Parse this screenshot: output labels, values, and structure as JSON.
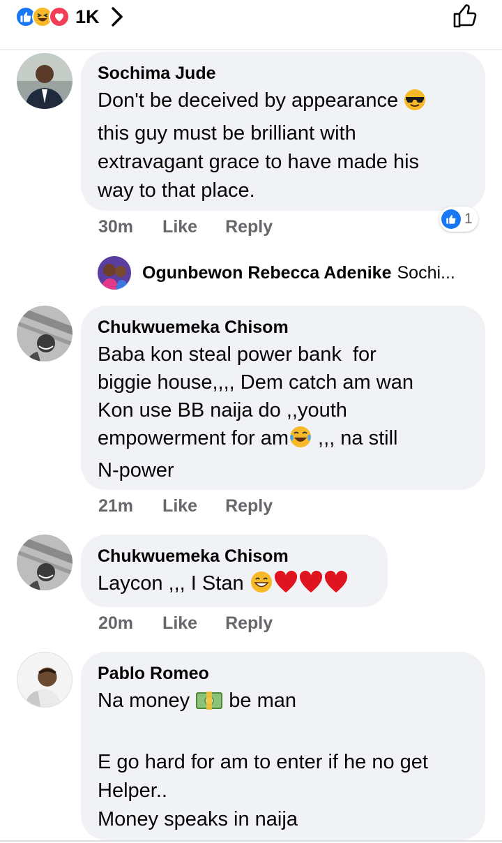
{
  "reactions_bar": {
    "count": "1K",
    "icons": [
      "like-icon",
      "haha-icon",
      "love-icon"
    ],
    "colors": {
      "like": "#1877f2",
      "haha": "#f7b928",
      "love": "#f33e58"
    }
  },
  "actions": {
    "like_label": "Like",
    "reply_label": "Reply"
  },
  "comments": [
    {
      "author": "Sochima Jude",
      "lines": [
        "Don't be deceived by appearance",
        "this guy must be brilliant with",
        "extravagant grace to have made his",
        "way to that place."
      ],
      "emoji": "sunglasses-emoji",
      "time": "30m",
      "reaction_count": "1",
      "reply_preview": {
        "author": "Ogunbewon Rebecca Adenike",
        "snippet": "Sochi..."
      }
    },
    {
      "author": "Chukwuemeka Chisom",
      "lines": [
        "Baba kon steal power bank  for",
        "biggie house,,,, Dem catch am wan",
        "Kon use BB naija do ,,youth",
        "empowerment for am",
        " ,,, na still",
        "N-power"
      ],
      "emoji": "crying-laughing-emoji",
      "time": "21m"
    },
    {
      "author": "Chukwuemeka Chisom",
      "text": "Laycon ,,, I Stan ",
      "emoji": "grin-and-three-hearts",
      "time": "20m"
    },
    {
      "author": "Pablo Romeo",
      "line1_a": "Na money ",
      "line1_b": " be man",
      "line2": "E go hard for am to enter if he no get",
      "line3": "Helper..",
      "line4": "Money speaks in naija",
      "emoji": "money-emoji"
    }
  ]
}
